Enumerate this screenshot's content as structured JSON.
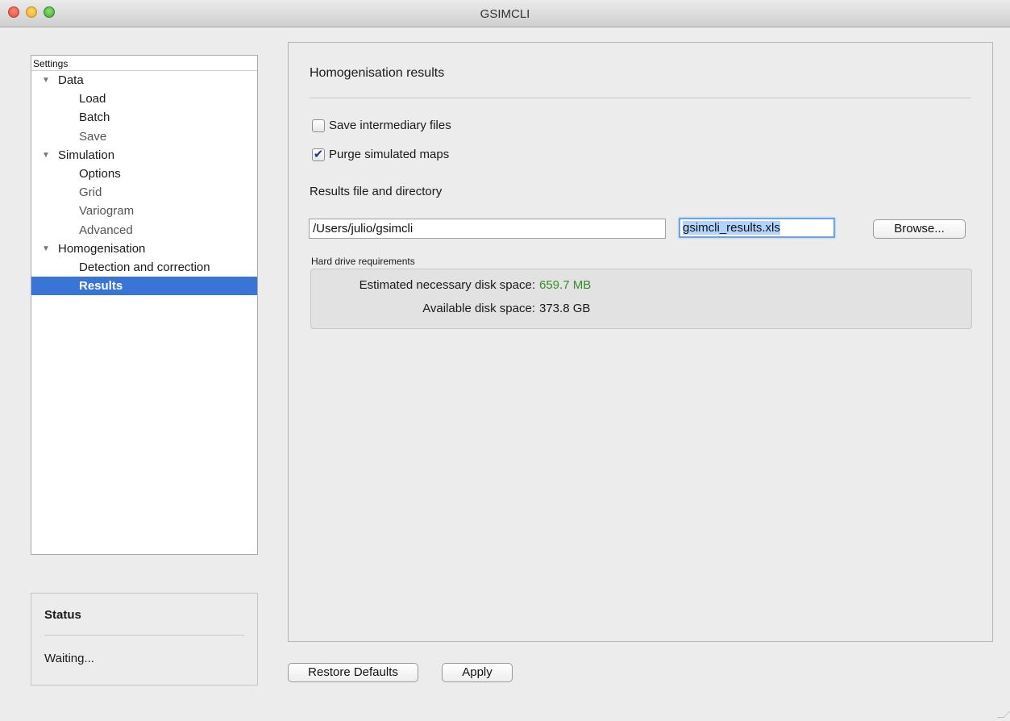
{
  "window": {
    "title": "GSIMCLI"
  },
  "tree": {
    "header": "Settings",
    "items": [
      {
        "label": "Data",
        "level": 0,
        "expanded": true
      },
      {
        "label": "Load",
        "level": 1,
        "enabled": true
      },
      {
        "label": "Batch",
        "level": 1,
        "enabled": true
      },
      {
        "label": "Save",
        "level": 1,
        "enabled": false
      },
      {
        "label": "Simulation",
        "level": 0,
        "expanded": true
      },
      {
        "label": "Options",
        "level": 1,
        "enabled": true
      },
      {
        "label": "Grid",
        "level": 1,
        "enabled": false
      },
      {
        "label": "Variogram",
        "level": 1,
        "enabled": false
      },
      {
        "label": "Advanced",
        "level": 1,
        "enabled": false
      },
      {
        "label": "Homogenisation",
        "level": 0,
        "expanded": true
      },
      {
        "label": "Detection and correction",
        "level": 1,
        "enabled": true
      },
      {
        "label": "Results",
        "level": 1,
        "enabled": true,
        "selected": true
      }
    ]
  },
  "status": {
    "title": "Status",
    "text": "Waiting..."
  },
  "panel": {
    "title": "Homogenisation results",
    "save_intermediary": {
      "label": "Save intermediary files",
      "checked": false
    },
    "purge_maps": {
      "label": "Purge simulated maps",
      "checked": true
    },
    "results_label": "Results file and directory",
    "directory_value": "/Users/julio/gsimcli",
    "filename_value": "gsimcli_results.xls",
    "browse_label": "Browse...",
    "hard_drive": {
      "title": "Hard drive requirements",
      "estimated_label": "Estimated necessary disk space:",
      "estimated_value": "659.7 MB",
      "available_label": "Available disk space:",
      "available_value": "373.8 GB"
    }
  },
  "footer": {
    "restore_label": "Restore Defaults",
    "apply_label": "Apply"
  },
  "colors": {
    "selection": "#3875d7",
    "estimate_value": "#3a8a2e",
    "window_bg": "#ececec"
  }
}
